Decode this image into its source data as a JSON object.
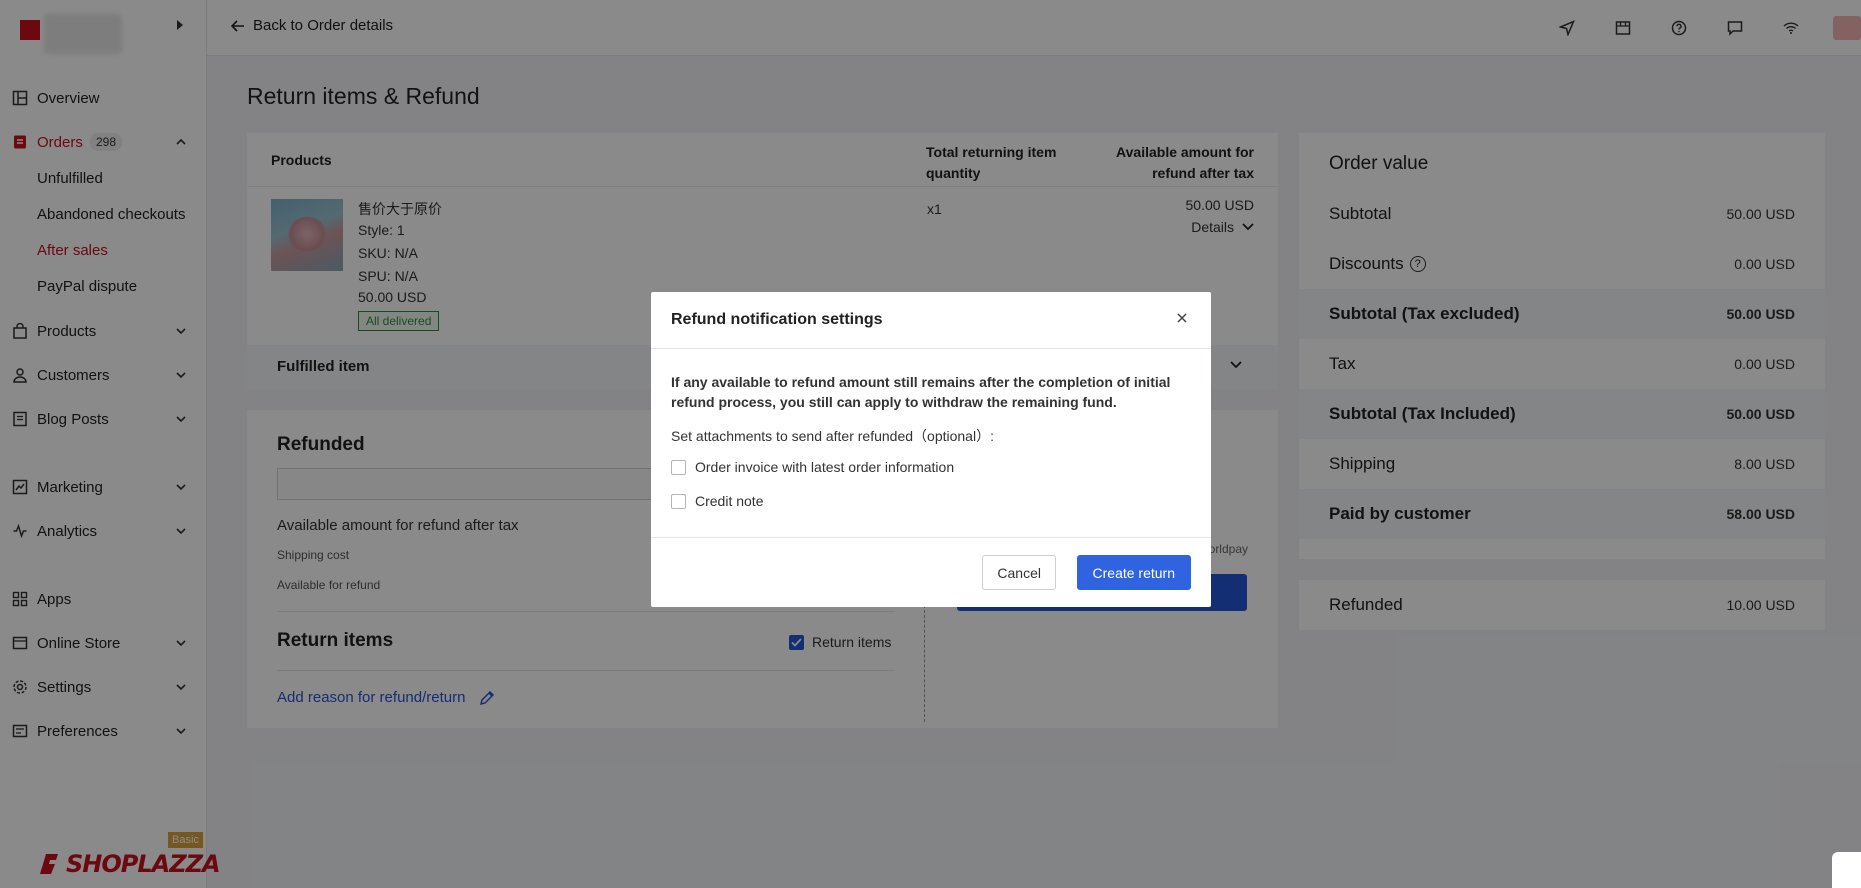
{
  "topbar": {
    "back_label": "Back to Order details",
    "icons": [
      "send-icon",
      "store-icon",
      "help-icon",
      "chat-icon",
      "wifi-icon"
    ]
  },
  "sidebar": {
    "items": [
      {
        "label": "Overview",
        "icon": "overview-icon"
      },
      {
        "label": "Orders",
        "icon": "orders-icon",
        "badge": "298"
      },
      {
        "label": "Products",
        "icon": "bag-icon"
      },
      {
        "label": "Customers",
        "icon": "person-icon"
      },
      {
        "label": "Blog Posts",
        "icon": "blog-icon"
      },
      {
        "label": "Marketing",
        "icon": "marketing-icon"
      },
      {
        "label": "Analytics",
        "icon": "analytics-icon"
      },
      {
        "label": "Apps",
        "icon": "apps-icon"
      },
      {
        "label": "Online Store",
        "icon": "store-icon"
      },
      {
        "label": "Settings",
        "icon": "gear-icon"
      },
      {
        "label": "Preferences",
        "icon": "preferences-icon"
      }
    ],
    "order_sub": [
      "Unfulfilled",
      "Abandoned checkouts",
      "After sales",
      "PayPal dispute"
    ],
    "plan_tag": "Basic",
    "brand": "SHOPLAZZA"
  },
  "page": {
    "title": "Return items & Refund"
  },
  "products": {
    "col_products": "Products",
    "col_qty": "Total returning item quantity",
    "col_amount": "Available amount for refund after tax",
    "item": {
      "name": "售价大于原价",
      "style": "Style:  1",
      "sku": "SKU: N/A",
      "spu": "SPU: N/A",
      "price": "50.00 USD",
      "status": "All delivered",
      "qty": "x1",
      "amount": "50.00 USD",
      "details": "Details"
    },
    "fulfilled": "Fulfilled item"
  },
  "refunded": {
    "title": "Refunded",
    "available": "Available amount for refund after tax",
    "shipping_cost": "Shipping cost",
    "available_refund": "Available for refund",
    "return_items_title": "Return items",
    "return_items_check": "Return items",
    "add_reason": "Add reason for refund/return",
    "worldpay": "orldpay"
  },
  "order_value": {
    "title": "Order value",
    "rows": [
      {
        "k": "Subtotal",
        "v": "50.00 USD"
      },
      {
        "k": "Discounts",
        "v": "0.00 USD"
      },
      {
        "k": "Subtotal (Tax excluded)",
        "v": "50.00 USD"
      },
      {
        "k": "Tax",
        "v": "0.00 USD"
      },
      {
        "k": "Subtotal (Tax Included)",
        "v": "50.00 USD"
      },
      {
        "k": "Shipping",
        "v": "8.00 USD"
      },
      {
        "k": "Paid by customer",
        "v": "58.00 USD"
      }
    ],
    "refunded_label": "Refunded",
    "refunded_value": "10.00 USD"
  },
  "modal": {
    "title": "Refund notification settings",
    "info": "If any available to refund amount still remains after the completion of initial refund process, you still can apply to withdraw the remaining fund.",
    "attachments_label": "Set attachments to send after refunded（optional）:",
    "option_invoice": "Order invoice with latest order information",
    "option_credit": "Credit note",
    "cancel": "Cancel",
    "create": "Create return"
  }
}
